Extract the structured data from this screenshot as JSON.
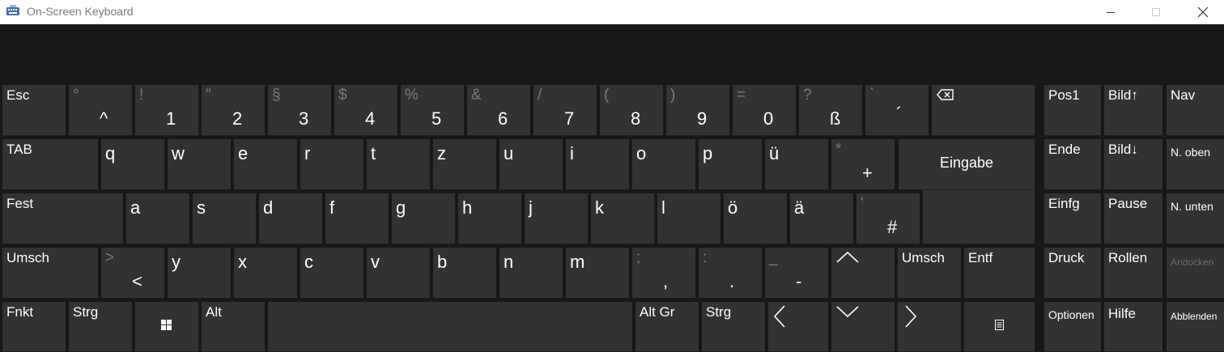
{
  "window": {
    "title": "On-Screen Keyboard",
    "colors": {
      "titlebar": "#ffffff",
      "background": "#191717",
      "key": "#323232",
      "text": "#ffffff",
      "secondary_text": "#7a7a7a"
    },
    "controls": {
      "minimize_icon": "minimize-icon",
      "maximize_icon": "maximize-icon",
      "close_icon": "close-icon"
    }
  },
  "keys": {
    "esc": "Esc",
    "k1": {
      "top": "°",
      "main": "^"
    },
    "k2": {
      "top": "!",
      "main": "1"
    },
    "k3": {
      "top": "\"",
      "main": "2"
    },
    "k4": {
      "top": "§",
      "main": "3"
    },
    "k5": {
      "top": "$",
      "main": "4"
    },
    "k6": {
      "top": "%",
      "main": "5"
    },
    "k7": {
      "top": "&",
      "main": "6"
    },
    "k8": {
      "top": "/",
      "main": "7"
    },
    "k9": {
      "top": "(",
      "main": "8"
    },
    "k10": {
      "top": ")",
      "main": "9"
    },
    "k11": {
      "top": "=",
      "main": "0"
    },
    "k12": {
      "top": "?",
      "main": "ß"
    },
    "k13": {
      "top": "`",
      "main": "´"
    },
    "tab": "TAB",
    "q": "q",
    "w": "w",
    "e": "e",
    "r": "r",
    "t": "t",
    "z": "z",
    "u": "u",
    "i": "i",
    "o": "o",
    "p": "p",
    "ue": "ü",
    "plus": {
      "top": "*",
      "main": "+"
    },
    "eingabe": "Eingabe",
    "fest": "Fest",
    "a": "a",
    "s": "s",
    "d": "d",
    "f": "f",
    "g": "g",
    "h": "h",
    "j": "j",
    "k": "k",
    "l": "l",
    "oe": "ö",
    "ae": "ä",
    "hash": {
      "top": "'",
      "main": "#"
    },
    "umsch_left": "Umsch",
    "lt": {
      "top": ">",
      "main": "<"
    },
    "y": "y",
    "x": "x",
    "c": "c",
    "v": "v",
    "b": "b",
    "n": "n",
    "m": "m",
    "comma": {
      "top": ";",
      "main": ","
    },
    "period": {
      "top": ":",
      "main": "."
    },
    "minus": {
      "top": "_",
      "main": "-"
    },
    "umsch_right": "Umsch",
    "entf": "Entf",
    "fnkt": "Fnkt",
    "strg_left": "Strg",
    "alt": "Alt",
    "altgr": "Alt Gr",
    "strg_right": "Strg",
    "pos1": "Pos1",
    "bild_up": "Bild↑",
    "nav": "Nav",
    "ende": "Ende",
    "bild_down": "Bild↓",
    "n_oben": "N. oben",
    "einfg": "Einfg",
    "pause": "Pause",
    "n_unten": "N. unten",
    "druck": "Druck",
    "rollen": "Rollen",
    "andocken": "Andocken",
    "optionen": "Optionen",
    "hilfe": "Hilfe",
    "abblenden": "Abblenden"
  }
}
